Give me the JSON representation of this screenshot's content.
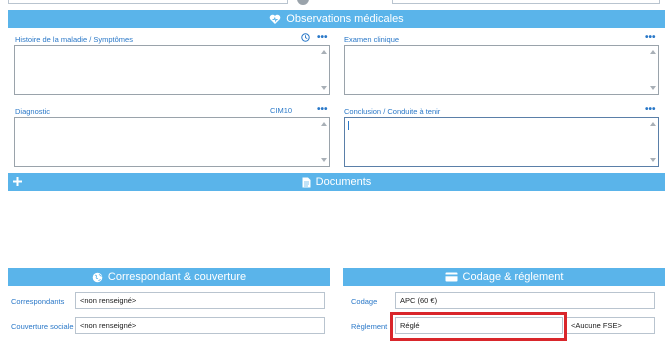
{
  "sections": {
    "observations": {
      "title": "Observations  médicales",
      "histoire_label": "Histoire de la maladie / Symptômes",
      "examen_label": "Examen clinique",
      "diagnostic_label": "Diagnostic",
      "cim10_label": "CIM10",
      "conclusion_label": "Conclusion / Conduite à tenir",
      "more_glyph": "•••"
    },
    "documents": {
      "title": "Documents"
    },
    "correspondant": {
      "title": "Correspondant  & couverture",
      "correspondants_label": "Correspondants",
      "correspondants_value": "<non renseigné>",
      "couverture_label": "Couverture sociale",
      "couverture_value": "<non renseigné>"
    },
    "codage": {
      "title": "Codage  & réglement",
      "codage_label": "Codage",
      "codage_value": "APC (60 €)",
      "reglement_label": "Règlement",
      "reglement_value": "Réglé",
      "fse_value": "<Aucune FSE>"
    }
  },
  "colors": {
    "section_bar": "#5ab4ea",
    "label_blue": "#2a78c8",
    "highlight_red": "#d9262b"
  },
  "icons": {
    "observations": "heart-stethoscope-icon",
    "documents": "document-icon",
    "add": "plus-icon",
    "correspondant": "globe-icon",
    "codage": "credit-card-icon",
    "history": "clock-icon"
  }
}
